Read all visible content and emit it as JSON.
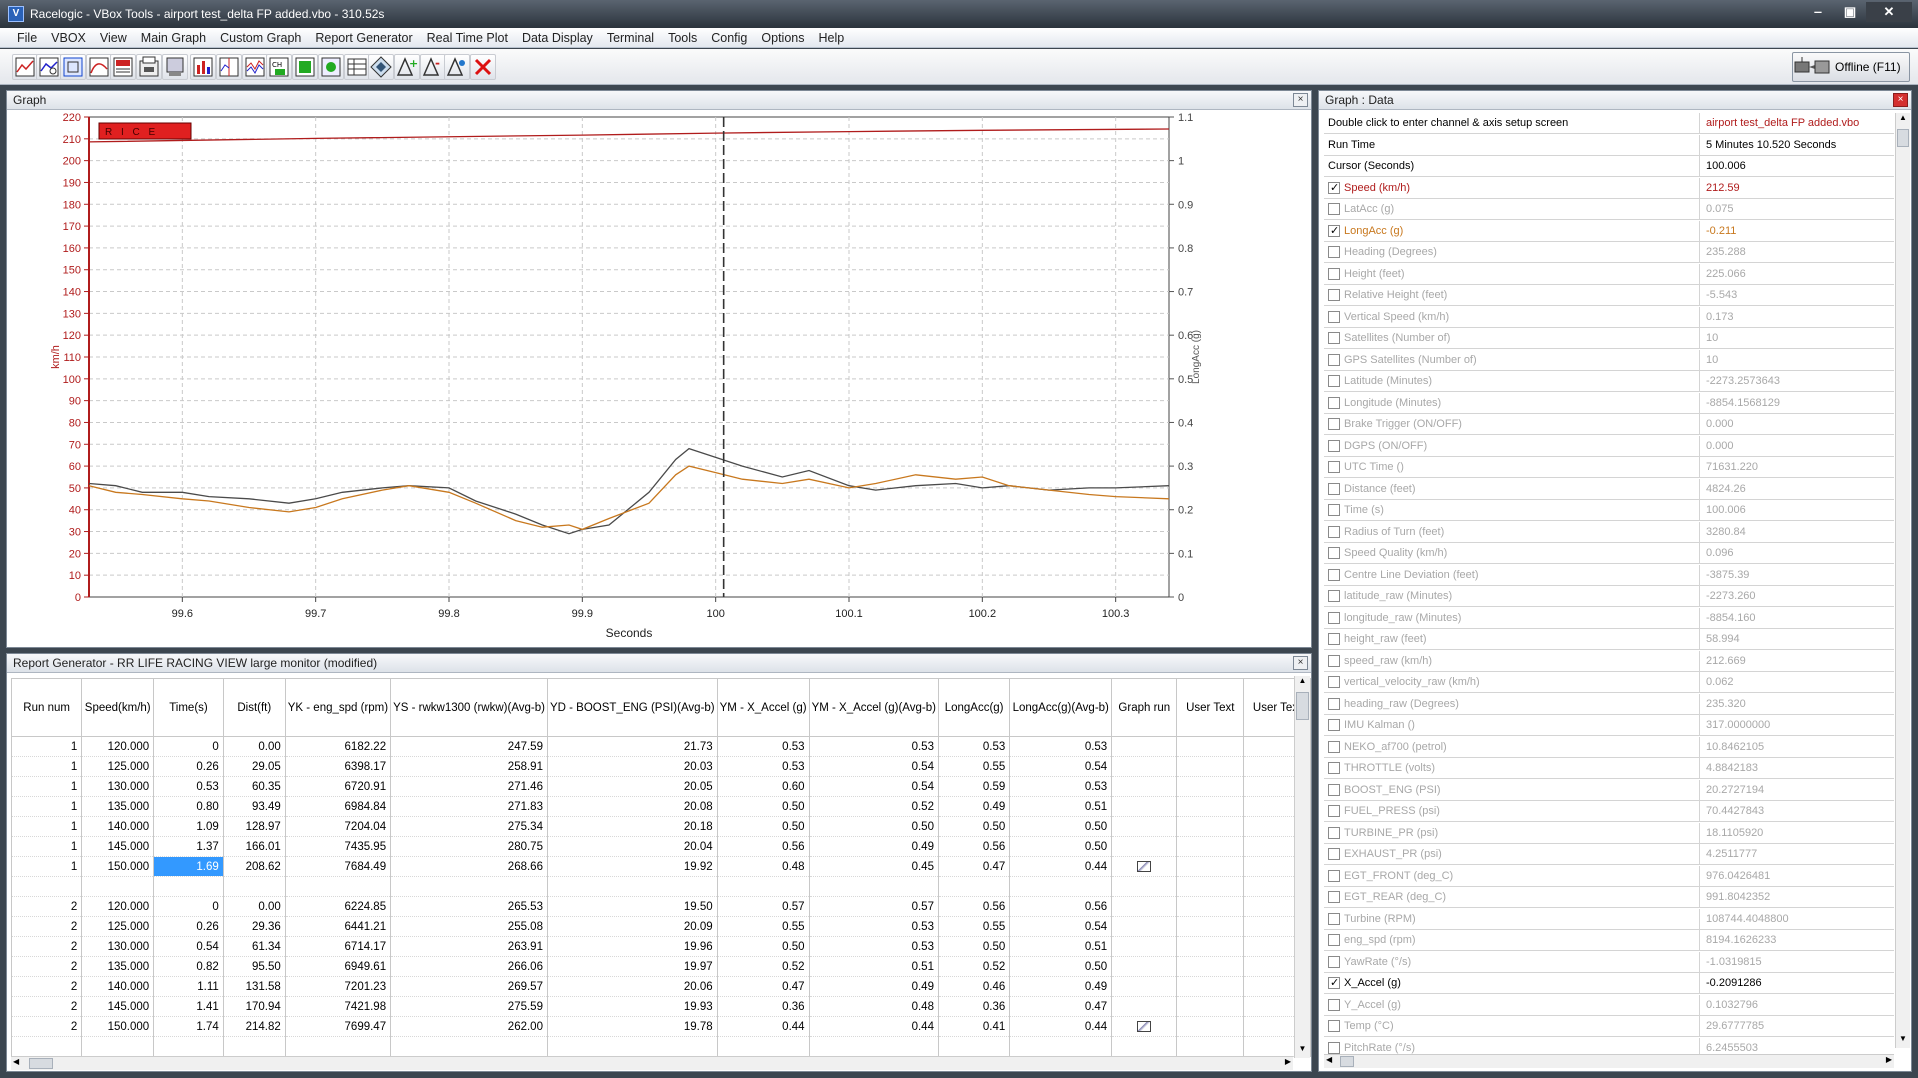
{
  "window": {
    "title": "Racelogic - VBox Tools - airport test_delta FP added.vbo - 310.52s",
    "app_icon": "V"
  },
  "menu": [
    "File",
    "VBOX",
    "View",
    "Main Graph",
    "Custom Graph",
    "Report Generator",
    "Real Time Plot",
    "Data Display",
    "Terminal",
    "Tools",
    "Config",
    "Options",
    "Help"
  ],
  "toolbar": {
    "icons": [
      "graph-icon",
      "graph-zoom-icon",
      "graph-select-icon",
      "graph-curve-icon",
      "report-icon",
      "graph-grid-icon",
      "print-icon",
      "graph-bar-icon",
      "graph-split-icon",
      "graph-compare-icon",
      "graph-layers-icon",
      "channel-icon",
      "image-export-icon",
      "table-icon",
      "diamond-icon",
      "add-marker-icon",
      "remove-marker-icon",
      "edit-marker-icon",
      "delete-icon"
    ],
    "offline_label": "Offline (F11)",
    "offline_icon": "vbox-device-icon"
  },
  "graph_panel": {
    "title": "Graph",
    "close": "×"
  },
  "chart_data": {
    "type": "line",
    "xlabel": "Seconds",
    "ylabel_left": "km/h",
    "ylabel_right": "LongAcc (g)",
    "xlim": [
      99.53,
      100.34
    ],
    "ylim_left": [
      0,
      220
    ],
    "ylim_right": [
      0,
      1.1
    ],
    "xticks": [
      99.6,
      99.7,
      99.8,
      99.9,
      100,
      100.1,
      100.2,
      100.3
    ],
    "yticks_left": [
      0,
      10,
      20,
      30,
      40,
      50,
      60,
      70,
      80,
      90,
      100,
      110,
      120,
      130,
      140,
      150,
      160,
      170,
      180,
      190,
      200,
      210,
      220
    ],
    "yticks_right": [
      0,
      0.1,
      0.2,
      0.3,
      0.4,
      0.5,
      0.6,
      0.7,
      0.8,
      0.9,
      1,
      1.1
    ],
    "cursor_x": 100.006,
    "grid": true,
    "lap_banner": "R I C E",
    "series": [
      {
        "name": "Speed (km/h)",
        "axis": "left",
        "color": "#b01c1c",
        "x": [
          99.53,
          99.7,
          99.9,
          100.0,
          100.1,
          100.2,
          100.34
        ],
        "y": [
          208.6,
          210.2,
          211.7,
          212.6,
          213.3,
          213.9,
          214.5
        ]
      },
      {
        "name": "X_Accel (g)",
        "axis": "right",
        "color": "#4a4a4a",
        "x": [
          99.53,
          99.55,
          99.57,
          99.6,
          99.62,
          99.65,
          99.68,
          99.7,
          99.72,
          99.75,
          99.77,
          99.8,
          99.82,
          99.85,
          99.87,
          99.89,
          99.9,
          99.92,
          99.95,
          99.97,
          99.98,
          100.0,
          100.02,
          100.05,
          100.07,
          100.1,
          100.12,
          100.15,
          100.18,
          100.2,
          100.22,
          100.25,
          100.28,
          100.3,
          100.34
        ],
        "y": [
          0.26,
          0.255,
          0.24,
          0.24,
          0.23,
          0.225,
          0.215,
          0.225,
          0.24,
          0.25,
          0.255,
          0.25,
          0.22,
          0.19,
          0.165,
          0.145,
          0.155,
          0.165,
          0.24,
          0.315,
          0.34,
          0.32,
          0.3,
          0.275,
          0.29,
          0.255,
          0.245,
          0.255,
          0.26,
          0.25,
          0.255,
          0.245,
          0.25,
          0.25,
          0.255
        ]
      },
      {
        "name": "LongAcc (g)",
        "axis": "right",
        "color": "#c8781e",
        "x": [
          99.53,
          99.55,
          99.57,
          99.6,
          99.62,
          99.65,
          99.68,
          99.7,
          99.72,
          99.75,
          99.77,
          99.8,
          99.82,
          99.85,
          99.87,
          99.89,
          99.9,
          99.92,
          99.95,
          99.97,
          99.98,
          100.0,
          100.02,
          100.05,
          100.07,
          100.1,
          100.12,
          100.15,
          100.18,
          100.2,
          100.22,
          100.25,
          100.28,
          100.3,
          100.34
        ],
        "y": [
          0.255,
          0.24,
          0.235,
          0.225,
          0.22,
          0.205,
          0.195,
          0.205,
          0.225,
          0.245,
          0.255,
          0.24,
          0.215,
          0.175,
          0.16,
          0.165,
          0.155,
          0.18,
          0.215,
          0.28,
          0.3,
          0.285,
          0.27,
          0.26,
          0.27,
          0.25,
          0.26,
          0.28,
          0.27,
          0.275,
          0.255,
          0.245,
          0.235,
          0.23,
          0.225
        ]
      }
    ]
  },
  "report_panel": {
    "title": "Report Generator - RR LIFE RACING VIEW large monitor (modified)",
    "close": "×",
    "columns": [
      "Run num",
      "Speed(km/h)",
      "Time(s)",
      "Dist(ft)",
      "YK - eng_spd (rpm)",
      "YS - rwkw1300 (rwkw)(Avg-b)",
      "YD - BOOST_ENG (PSI)(Avg-b)",
      "YM - X_Accel (g)",
      "YM - X_Accel (g)(Avg-b)",
      "LongAcc(g)",
      "LongAcc(g)(Avg-b)",
      "Graph run",
      "User Text",
      "User Text"
    ],
    "rows": [
      [
        "1",
        "120.000",
        "0",
        "0.00",
        "6182.22",
        "247.59",
        "21.73",
        "0.53",
        "0.53",
        "0.53",
        "0.53",
        "",
        "",
        ""
      ],
      [
        "1",
        "125.000",
        "0.26",
        "29.05",
        "6398.17",
        "258.91",
        "20.03",
        "0.53",
        "0.54",
        "0.55",
        "0.54",
        "",
        "",
        ""
      ],
      [
        "1",
        "130.000",
        "0.53",
        "60.35",
        "6720.91",
        "271.46",
        "20.05",
        "0.60",
        "0.54",
        "0.59",
        "0.53",
        "",
        "",
        ""
      ],
      [
        "1",
        "135.000",
        "0.80",
        "93.49",
        "6984.84",
        "271.83",
        "20.08",
        "0.50",
        "0.52",
        "0.49",
        "0.51",
        "",
        "",
        ""
      ],
      [
        "1",
        "140.000",
        "1.09",
        "128.97",
        "7204.04",
        "275.34",
        "20.18",
        "0.50",
        "0.50",
        "0.50",
        "0.50",
        "",
        "",
        ""
      ],
      [
        "1",
        "145.000",
        "1.37",
        "166.01",
        "7435.95",
        "280.75",
        "20.04",
        "0.56",
        "0.49",
        "0.56",
        "0.50",
        "",
        "",
        ""
      ],
      [
        "1",
        "150.000",
        "1.69",
        "208.62",
        "7684.49",
        "268.66",
        "19.92",
        "0.48",
        "0.45",
        "0.47",
        "0.44",
        "graph",
        "",
        ""
      ],
      [
        "",
        "",
        "",
        "",
        "",
        "",
        "",
        "",
        "",
        "",
        "",
        "",
        "",
        ""
      ],
      [
        "2",
        "120.000",
        "0",
        "0.00",
        "6224.85",
        "265.53",
        "19.50",
        "0.57",
        "0.57",
        "0.56",
        "0.56",
        "",
        "",
        ""
      ],
      [
        "2",
        "125.000",
        "0.26",
        "29.36",
        "6441.21",
        "255.08",
        "20.09",
        "0.55",
        "0.53",
        "0.55",
        "0.54",
        "",
        "",
        ""
      ],
      [
        "2",
        "130.000",
        "0.54",
        "61.34",
        "6714.17",
        "263.91",
        "19.96",
        "0.50",
        "0.53",
        "0.50",
        "0.51",
        "",
        "",
        ""
      ],
      [
        "2",
        "135.000",
        "0.82",
        "95.50",
        "6949.61",
        "266.06",
        "19.97",
        "0.52",
        "0.51",
        "0.52",
        "0.50",
        "",
        "",
        ""
      ],
      [
        "2",
        "140.000",
        "1.11",
        "131.58",
        "7201.23",
        "269.57",
        "20.06",
        "0.47",
        "0.49",
        "0.46",
        "0.49",
        "",
        "",
        ""
      ],
      [
        "2",
        "145.000",
        "1.41",
        "170.94",
        "7421.98",
        "275.59",
        "19.93",
        "0.36",
        "0.48",
        "0.36",
        "0.47",
        "",
        "",
        ""
      ],
      [
        "2",
        "150.000",
        "1.74",
        "214.82",
        "7699.47",
        "262.00",
        "19.78",
        "0.44",
        "0.44",
        "0.41",
        "0.44",
        "graph",
        "",
        ""
      ],
      [
        "",
        "",
        "",
        "",
        "",
        "",
        "",
        "",
        "",
        "",
        "",
        "",
        "",
        ""
      ]
    ]
  },
  "data_panel": {
    "title": "Graph : Data",
    "close": "×",
    "rows": [
      {
        "label": "Double click to enter channel & axis setup screen",
        "value": "airport test_delta FP added.vbo",
        "cb": "none",
        "style": "plain",
        "vstyle": "red"
      },
      {
        "label": "Run Time",
        "value": "5 Minutes 10.520 Seconds",
        "cb": "none",
        "style": "plain",
        "vstyle": ""
      },
      {
        "label": "Cursor (Seconds)",
        "value": "100.006",
        "cb": "none",
        "style": "red-plain",
        "vstyle": ""
      },
      {
        "label": "Speed (km/h)",
        "value": "212.59",
        "cb": "on",
        "style": "red",
        "vstyle": "red"
      },
      {
        "label": "LatAcc (g)",
        "value": "0.075",
        "cb": "off",
        "style": "gray",
        "vstyle": "gray"
      },
      {
        "label": "LongAcc (g)",
        "value": "-0.211",
        "cb": "on",
        "style": "orange",
        "vstyle": "orange"
      },
      {
        "label": "Heading (Degrees)",
        "value": "235.288",
        "cb": "off",
        "style": "gray",
        "vstyle": "gray"
      },
      {
        "label": "Height (feet)",
        "value": "225.066",
        "cb": "off",
        "style": "gray",
        "vstyle": "gray"
      },
      {
        "label": "Relative Height (feet)",
        "value": "-5.543",
        "cb": "off",
        "style": "gray",
        "vstyle": "gray"
      },
      {
        "label": "Vertical Speed (km/h)",
        "value": "0.173",
        "cb": "off",
        "style": "gray",
        "vstyle": "gray"
      },
      {
        "label": "Satellites (Number of)",
        "value": "10",
        "cb": "off",
        "style": "gray",
        "vstyle": "gray"
      },
      {
        "label": "GPS Satellites (Number of)",
        "value": "10",
        "cb": "off",
        "style": "gray",
        "vstyle": "gray"
      },
      {
        "label": "Latitude (Minutes)",
        "value": "-2273.2573643",
        "cb": "off",
        "style": "gray",
        "vstyle": "gray"
      },
      {
        "label": "Longitude (Minutes)",
        "value": "-8854.1568129",
        "cb": "off",
        "style": "gray",
        "vstyle": "gray"
      },
      {
        "label": "Brake Trigger (ON/OFF)",
        "value": "0.000",
        "cb": "off",
        "style": "gray",
        "vstyle": "gray"
      },
      {
        "label": "DGPS (ON/OFF)",
        "value": "0.000",
        "cb": "off",
        "style": "gray",
        "vstyle": "gray"
      },
      {
        "label": "UTC Time ()",
        "value": "71631.220",
        "cb": "off",
        "style": "gray",
        "vstyle": "gray"
      },
      {
        "label": "Distance (feet)",
        "value": "4824.26",
        "cb": "off",
        "style": "gray",
        "vstyle": "gray"
      },
      {
        "label": "Time (s)",
        "value": "100.006",
        "cb": "off",
        "style": "gray",
        "vstyle": "gray"
      },
      {
        "label": "Radius of Turn (feet)",
        "value": "3280.84",
        "cb": "off",
        "style": "gray",
        "vstyle": "gray"
      },
      {
        "label": "Speed Quality (km/h)",
        "value": "0.096",
        "cb": "off",
        "style": "gray",
        "vstyle": "gray"
      },
      {
        "label": "Centre Line Deviation (feet)",
        "value": "-3875.39",
        "cb": "off",
        "style": "gray",
        "vstyle": "gray"
      },
      {
        "label": "latitude_raw (Minutes)",
        "value": "-2273.260",
        "cb": "off",
        "style": "gray",
        "vstyle": "gray"
      },
      {
        "label": "longitude_raw (Minutes)",
        "value": "-8854.160",
        "cb": "off",
        "style": "gray",
        "vstyle": "gray"
      },
      {
        "label": "height_raw (feet)",
        "value": "58.994",
        "cb": "off",
        "style": "gray",
        "vstyle": "gray"
      },
      {
        "label": "speed_raw (km/h)",
        "value": "212.669",
        "cb": "off",
        "style": "gray",
        "vstyle": "gray"
      },
      {
        "label": "vertical_velocity_raw (km/h)",
        "value": "0.062",
        "cb": "off",
        "style": "gray",
        "vstyle": "gray"
      },
      {
        "label": "heading_raw (Degrees)",
        "value": "235.320",
        "cb": "off",
        "style": "gray",
        "vstyle": "gray"
      },
      {
        "label": "IMU Kalman ()",
        "value": "317.0000000",
        "cb": "off",
        "style": "gray",
        "vstyle": "gray"
      },
      {
        "label": "NEKO_af700 (petrol)",
        "value": "10.8462105",
        "cb": "off",
        "style": "gray",
        "vstyle": "gray"
      },
      {
        "label": "THROTTLE (volts)",
        "value": "4.8842183",
        "cb": "off",
        "style": "gray",
        "vstyle": "gray"
      },
      {
        "label": "BOOST_ENG (PSI)",
        "value": "20.2727194",
        "cb": "off",
        "style": "gray",
        "vstyle": "gray"
      },
      {
        "label": "FUEL_PRESS (psi)",
        "value": "70.4427843",
        "cb": "off",
        "style": "gray",
        "vstyle": "gray"
      },
      {
        "label": "TURBINE_PR (psi)",
        "value": "18.1105920",
        "cb": "off",
        "style": "gray",
        "vstyle": "gray"
      },
      {
        "label": "EXHAUST_PR (psi)",
        "value": "4.2511777",
        "cb": "off",
        "style": "gray",
        "vstyle": "gray"
      },
      {
        "label": "EGT_FRONT (deg_C)",
        "value": "976.0426481",
        "cb": "off",
        "style": "gray",
        "vstyle": "gray"
      },
      {
        "label": "EGT_REAR (deg_C)",
        "value": "991.8042352",
        "cb": "off",
        "style": "gray",
        "vstyle": "gray"
      },
      {
        "label": "Turbine (RPM)",
        "value": "108744.4048800",
        "cb": "off",
        "style": "gray",
        "vstyle": "gray"
      },
      {
        "label": "eng_spd (rpm)",
        "value": "8194.1626233",
        "cb": "off",
        "style": "gray",
        "vstyle": "gray"
      },
      {
        "label": "YawRate (°/s)",
        "value": "-1.0319815",
        "cb": "off",
        "style": "gray",
        "vstyle": "gray"
      },
      {
        "label": "X_Accel (g)",
        "value": "-0.2091286",
        "cb": "on",
        "style": "plain-cb",
        "vstyle": ""
      },
      {
        "label": "Y_Accel (g)",
        "value": "0.1032796",
        "cb": "off",
        "style": "gray",
        "vstyle": "gray"
      },
      {
        "label": "Temp (°C)",
        "value": "29.6777785",
        "cb": "off",
        "style": "gray",
        "vstyle": "gray"
      },
      {
        "label": "PitchRate (°/s)",
        "value": "6.2455503",
        "cb": "off",
        "style": "gray",
        "vstyle": "gray"
      }
    ]
  },
  "colors": {
    "accent_red": "#b01c1c",
    "orange": "#c8781e",
    "selection": "#3399ff"
  }
}
